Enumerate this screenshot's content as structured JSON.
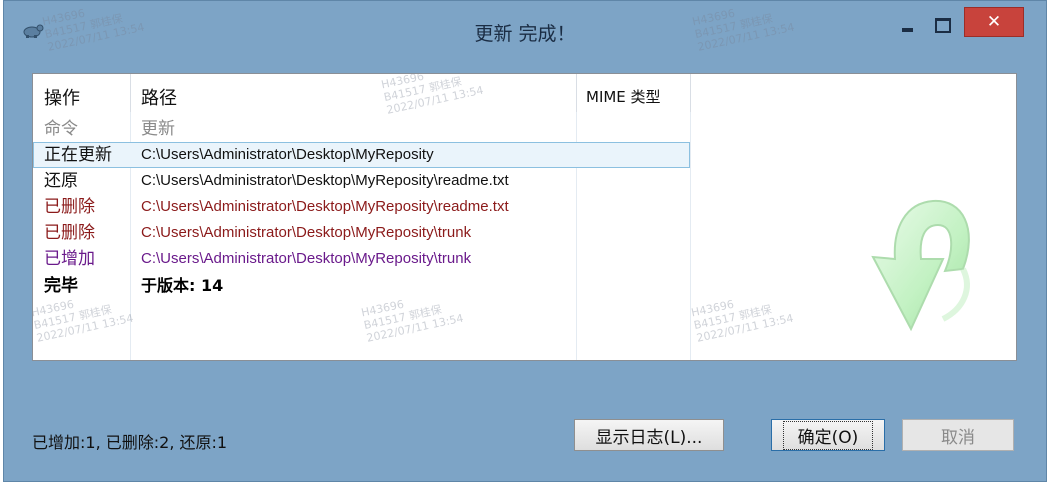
{
  "window": {
    "title": "更新 完成！",
    "controls": {
      "minimize": "–",
      "maximize": "□",
      "close": "✕"
    }
  },
  "table": {
    "headers": {
      "action": "操作",
      "path": "路径",
      "mime": "MIME 类型"
    },
    "rows": [
      {
        "action": "命令",
        "path": "更新",
        "style": "muted"
      },
      {
        "action": "正在更新",
        "path": "C:\\Users\\Administrator\\Desktop\\MyReposity",
        "style": "normal",
        "selected": true
      },
      {
        "action": "还原",
        "path": "C:\\Users\\Administrator\\Desktop\\MyReposity\\readme.txt",
        "style": "normal"
      },
      {
        "action": "已删除",
        "path": "C:\\Users\\Administrator\\Desktop\\MyReposity\\readme.txt",
        "style": "deleted"
      },
      {
        "action": "已删除",
        "path": "C:\\Users\\Administrator\\Desktop\\MyReposity\\trunk",
        "style": "deleted"
      },
      {
        "action": "已增加",
        "path": "C:\\Users\\Administrator\\Desktop\\MyReposity\\trunk",
        "style": "added"
      },
      {
        "action": "完毕",
        "path": "于版本: 14",
        "style": "bold"
      }
    ]
  },
  "watermark": {
    "line1": "H43696",
    "line2": "B41517 郭桂保",
    "line3": "2022/07/11  13:54"
  },
  "status": {
    "summary": "已增加:1, 已删除:2, 还原:1"
  },
  "buttons": {
    "show_log": "显示日志(L)...",
    "ok": "确定(O)",
    "cancel": "取消"
  },
  "colors": {
    "window_bg": "#7da4c6",
    "close_btn": "#c8433c",
    "deleted": "#8b1a1a",
    "added": "#6a1a8b",
    "arrow": "#9fe59f"
  },
  "icons": {
    "app": "tortoise-icon",
    "arrow": "green-update-arrow-icon"
  }
}
